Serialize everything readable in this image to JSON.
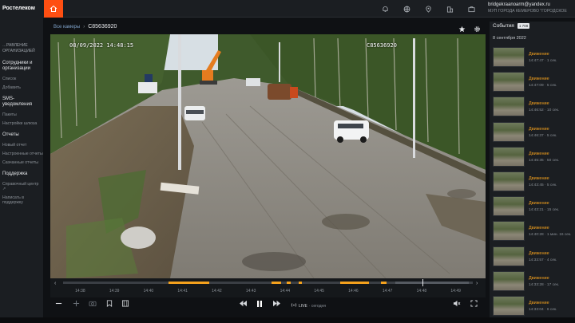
{
  "app": {
    "brand": "Ростелеком"
  },
  "user": {
    "email": "bridgekraanoarm@yandex.ru",
    "org": "МУП ГОРОДА КЕМЕРОВО \"ГОРОДСКОЕ"
  },
  "sidebar": {
    "sections": [
      {
        "head": "…РАВЛЕНИЕ ОРГАНИЗАЦИЕЙ",
        "dim": true,
        "items": []
      },
      {
        "head": "Сотрудники и организации",
        "items": [
          "Список",
          "Добавить"
        ]
      },
      {
        "head": "SMS-уведомления",
        "items": [
          "Пакеты",
          "Настройки шлюза"
        ]
      },
      {
        "head": "Отчеты",
        "items": [
          "Новый отчет",
          "Настроенные отчеты",
          "Скачанные отчеты"
        ]
      },
      {
        "head": "Поддержка",
        "items": [
          "Справочный центр ↗",
          "Написать в поддержку"
        ]
      }
    ]
  },
  "camera": {
    "breadcrumb_back": "Все камеры",
    "name": "C85636920",
    "osd_datetime": "08/09/2022 14:48:15",
    "osd_id": "C85636920"
  },
  "timeline": {
    "ticks": [
      "14:38",
      "14:39",
      "14:40",
      "14:41",
      "14:42",
      "14:43",
      "14:44",
      "14:45",
      "14:46",
      "14:47",
      "14:48",
      "14:49"
    ],
    "segments": [
      {
        "from": 0.258,
        "to": 0.357,
        "dark": false
      },
      {
        "from": 0.508,
        "to": 0.532,
        "dark": false
      },
      {
        "from": 0.545,
        "to": 0.556,
        "dark": false
      },
      {
        "from": 0.576,
        "to": 0.583,
        "dark": false
      },
      {
        "from": 0.677,
        "to": 0.746,
        "dark": false
      },
      {
        "from": 0.776,
        "to": 0.789,
        "dark": false
      },
      {
        "from": 0.811,
        "to": 0.877,
        "dark": true
      },
      {
        "from": 0.877,
        "to": 0.99,
        "dark": true
      }
    ],
    "cursor_position": 0.877
  },
  "controls": {
    "live_label": "LIVE",
    "live_sub": "· сегодня"
  },
  "events": {
    "title": "События",
    "badge": "1 708",
    "date": "8 сентября 2022",
    "items": [
      {
        "type": "Движение",
        "time": "14:47:47 · 1 сек."
      },
      {
        "type": "Движение",
        "time": "14:47:09 · 5 сек."
      },
      {
        "type": "Движение",
        "time": "14:46:52 · 10 сек."
      },
      {
        "type": "Движение",
        "time": "14:46:37 · 5 сек."
      },
      {
        "type": "Движение",
        "time": "14:45:35 · 50 сек."
      },
      {
        "type": "Движение",
        "time": "14:43:45 · 5 сек."
      },
      {
        "type": "Движение",
        "time": "14:43:21 · 15 сек."
      },
      {
        "type": "Движение",
        "time": "14:40:28 · 1 мин. 16 сек."
      },
      {
        "type": "Движение",
        "time": "14:33:57 · 4 сек."
      },
      {
        "type": "Движение",
        "time": "14:33:28 · 17 сек."
      },
      {
        "type": "Движение",
        "time": "14:33:04 · 6 сек."
      }
    ]
  }
}
